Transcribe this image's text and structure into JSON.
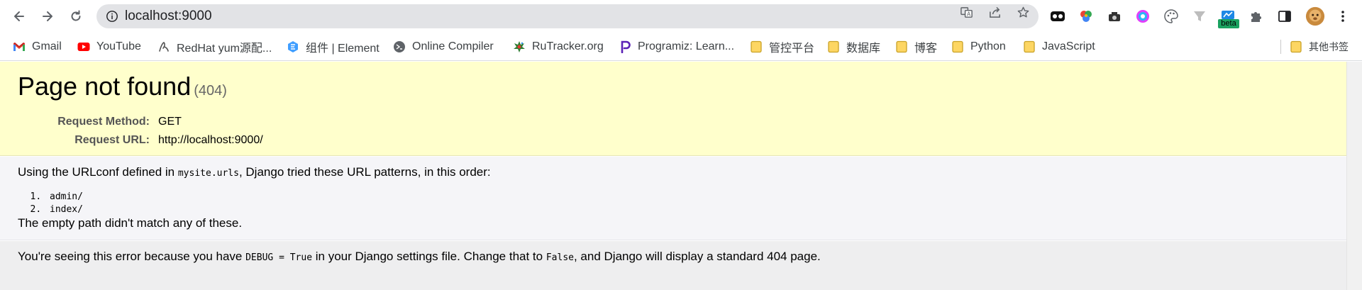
{
  "browser": {
    "url": "localhost:9000"
  },
  "bookmarks": [
    {
      "label": "Gmail",
      "icon": "gmail-icon"
    },
    {
      "label": "YouTube",
      "icon": "youtube-icon"
    },
    {
      "label": "RedHat yum源配...",
      "icon": "redhat-icon"
    },
    {
      "label": "组件 | Element",
      "icon": "element-icon"
    },
    {
      "label": "Online Compiler",
      "icon": "compiler-icon"
    },
    {
      "label": "RuTracker.org",
      "icon": "rutracker-icon"
    },
    {
      "label": "Programiz: Learn...",
      "icon": "programiz-icon"
    },
    {
      "label": "管控平台",
      "icon": "folder-icon"
    },
    {
      "label": "数据库",
      "icon": "folder-icon"
    },
    {
      "label": "博客",
      "icon": "folder-icon"
    },
    {
      "label": "Python",
      "icon": "folder-icon"
    },
    {
      "label": "JavaScript",
      "icon": "folder-icon"
    }
  ],
  "other_bookmarks": "其他书签",
  "extensions": {
    "beta_label": "beta"
  },
  "error": {
    "title": "Page not found",
    "code": "(404)",
    "request_method_label": "Request Method:",
    "request_method": "GET",
    "request_url_label": "Request URL:",
    "request_url": "http://localhost:9000/"
  },
  "info": {
    "intro_before": "Using the URLconf defined in ",
    "urlconf": "mysite.urls",
    "intro_after": ", Django tried these URL patterns, in this order:",
    "patterns": [
      "admin/",
      "index/"
    ],
    "no_match": "The empty path didn't match any of these."
  },
  "explanation": {
    "part1": "You're seeing this error because you have ",
    "debug_setting": "DEBUG = True",
    "part2": " in your Django settings file. Change that to ",
    "false_value": "False",
    "part3": ", and Django will display a standard 404 page."
  },
  "colors": {
    "summary_bg": "#ffffcc",
    "info_bg": "#f5f5f8",
    "explain_bg": "#eeeeef",
    "folder": "#fdd663"
  }
}
